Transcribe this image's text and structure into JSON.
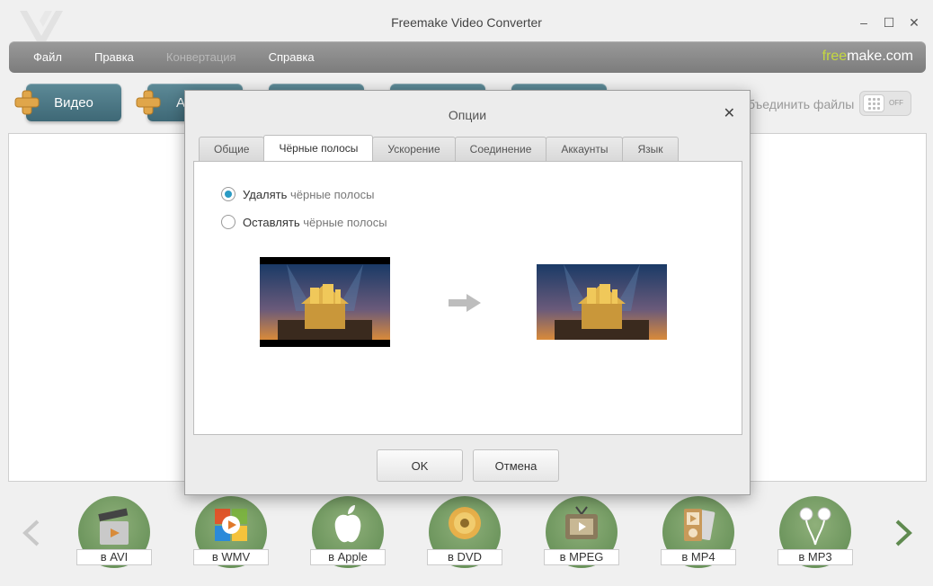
{
  "window": {
    "title": "Freemake Video Converter",
    "controls": {
      "minimize": "–",
      "maximize": "☐",
      "close": "✕"
    }
  },
  "menu": {
    "items": [
      {
        "label": "Файл",
        "enabled": true
      },
      {
        "label": "Правка",
        "enabled": true
      },
      {
        "label": "Конвертация",
        "enabled": false
      },
      {
        "label": "Справка",
        "enabled": true
      }
    ],
    "brand": {
      "prefix": "free",
      "suffix": "make.com"
    }
  },
  "toolbar": {
    "video_label": "Видео",
    "audio_label": "А",
    "merge_label": "бъединить файлы",
    "merge_toggle": "OFF"
  },
  "dialog": {
    "title": "Опции",
    "close": "✕",
    "tabs": [
      {
        "label": "Общие",
        "active": false
      },
      {
        "label": "Чёрные полосы",
        "active": true
      },
      {
        "label": "Ускорение",
        "active": false
      },
      {
        "label": "Соединение",
        "active": false
      },
      {
        "label": "Аккаунты",
        "active": false
      },
      {
        "label": "Язык",
        "active": false
      }
    ],
    "options": [
      {
        "verb": "Удалять",
        "rest": " чёрные полосы",
        "checked": true
      },
      {
        "verb": "Оставлять",
        "rest": " чёрные полосы",
        "checked": false
      }
    ],
    "ok_label": "OK",
    "cancel_label": "Отмена"
  },
  "formats": [
    {
      "label": "в AVI",
      "icon": "avi-clapper-icon"
    },
    {
      "label": "в WMV",
      "icon": "wmv-windows-icon"
    },
    {
      "label": "в Apple",
      "icon": "apple-icon"
    },
    {
      "label": "в DVD",
      "icon": "dvd-disc-icon"
    },
    {
      "label": "в MPEG",
      "icon": "mpeg-tv-icon"
    },
    {
      "label": "в MP4",
      "icon": "mp4-player-icon"
    },
    {
      "label": "в MP3",
      "icon": "mp3-headphones-icon"
    }
  ],
  "colors": {
    "accent": "#2a9bc4",
    "tool_button": "#4c7785",
    "format_green": "#6f9a5f",
    "brand_highlight": "#c5d93f"
  }
}
